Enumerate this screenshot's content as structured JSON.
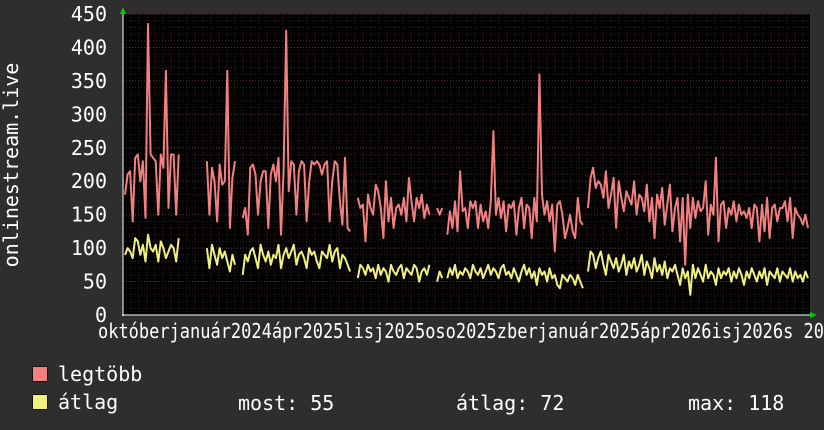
{
  "chart_data": {
    "type": "line",
    "ylabel": "onlinestream.live",
    "ylim": [
      0,
      450
    ],
    "yticks": [
      0,
      50,
      100,
      150,
      200,
      250,
      300,
      350,
      400,
      450
    ],
    "grid": true,
    "x_tick_labels": [
      "október",
      "2024 január",
      "2025 április",
      "2025 július",
      "2025 október",
      "2025 január",
      "2025 április",
      "2026 július",
      "2026 ..."
    ],
    "x_tick_label_text": "októberjanuár2024ápr2025lisj2025oso2025zberjanuár2025ápr2026isj2026s 20",
    "colors": {
      "background": "#2e2e2e",
      "plot": "#000000",
      "grid": "#5a2a2a",
      "axis": "#ffffff",
      "arrow": "#00cc00"
    },
    "series": [
      {
        "name": "legtöbb",
        "color": "#f28080",
        "values": [
          180,
          210,
          215,
          140,
          235,
          240,
          200,
          230,
          145,
          435,
          240,
          235,
          230,
          150,
          240,
          220,
          365,
          160,
          240,
          240,
          150,
          240,
          null,
          null,
          null,
          null,
          null,
          null,
          null,
          null,
          null,
          null,
          230,
          150,
          220,
          200,
          140,
          225,
          195,
          200,
          365,
          130,
          205,
          230,
          null,
          null,
          145,
          160,
          120,
          220,
          225,
          210,
          150,
          200,
          215,
          215,
          130,
          210,
          225,
          200,
          235,
          120,
          215,
          425,
          185,
          230,
          225,
          150,
          215,
          230,
          225,
          140,
          200,
          230,
          225,
          230,
          225,
          210,
          225,
          230,
          140,
          200,
          230,
          225,
          170,
          135,
          235,
          130,
          125,
          null,
          null,
          175,
          160,
          165,
          110,
          180,
          160,
          150,
          195,
          185,
          160,
          115,
          200,
          140,
          175,
          130,
          160,
          165,
          150,
          175,
          140,
          205,
          170,
          140,
          175,
          160,
          180,
          145,
          165,
          150,
          null,
          null,
          160,
          150,
          160,
          null,
          120,
          155,
          130,
          170,
          125,
          215,
          155,
          160,
          130,
          170,
          160,
          170,
          130,
          165,
          140,
          155,
          130,
          170,
          275,
          150,
          175,
          145,
          170,
          125,
          165,
          160,
          170,
          120,
          160,
          175,
          130,
          165,
          160,
          115,
          175,
          140,
          360,
          180,
          150,
          170,
          140,
          165,
          95,
          165,
          170,
          150,
          115,
          130,
          150,
          125,
          115,
          175,
          140,
          135,
          null,
          160,
          205,
          220,
          190,
          200,
          195,
          175,
          215,
          160,
          180,
          205,
          130,
          200,
          175,
          155,
          185,
          175,
          165,
          200,
          150,
          180,
          175,
          155,
          195,
          140,
          175,
          115,
          180,
          160,
          190,
          135,
          165,
          195,
          125,
          160,
          175,
          110,
          175,
          75,
          180,
          130,
          175,
          145,
          170,
          155,
          160,
          200,
          120,
          165,
          150,
          235,
          110,
          165,
          170,
          130,
          160,
          150,
          170,
          140,
          165,
          150,
          155,
          145,
          160,
          130,
          165,
          160,
          110,
          165,
          125,
          175,
          115,
          160,
          165,
          140,
          160,
          160,
          170,
          140,
          175,
          115,
          160,
          150,
          145,
          135,
          150,
          130
        ],
        "stats": {
          "most": 55,
          "atlag": 72,
          "max": 118
        }
      },
      {
        "name": "átlag",
        "color": "#f0f080",
        "values": [
          90,
          100,
          95,
          85,
          115,
          110,
          90,
          105,
          80,
          120,
          100,
          95,
          105,
          80,
          110,
          100,
          85,
          95,
          105,
          100,
          80,
          115,
          null,
          null,
          null,
          null,
          null,
          null,
          null,
          null,
          null,
          null,
          100,
          70,
          105,
          90,
          75,
          100,
          85,
          95,
          80,
          65,
          90,
          75,
          null,
          null,
          60,
          90,
          80,
          95,
          100,
          85,
          70,
          105,
          90,
          80,
          95,
          75,
          90,
          85,
          105,
          70,
          90,
          100,
          85,
          95,
          105,
          75,
          90,
          95,
          85,
          70,
          100,
          90,
          95,
          80,
          70,
          95,
          90,
          85,
          105,
          80,
          95,
          100,
          70,
          90,
          85,
          75,
          65,
          null,
          null,
          55,
          75,
          70,
          60,
          75,
          65,
          70,
          55,
          75,
          60,
          70,
          65,
          50,
          75,
          65,
          60,
          70,
          75,
          55,
          70,
          65,
          60,
          75,
          70,
          50,
          65,
          70,
          60,
          75,
          null,
          null,
          50,
          65,
          55,
          null,
          55,
          70,
          60,
          75,
          55,
          65,
          60,
          70,
          65,
          55,
          75,
          65,
          60,
          70,
          55,
          65,
          75,
          60,
          70,
          65,
          55,
          70,
          75,
          60,
          65,
          55,
          70,
          60,
          50,
          65,
          75,
          60,
          70,
          55,
          65,
          45,
          70,
          60,
          65,
          50,
          70,
          55,
          60,
          45,
          40,
          60,
          55,
          50,
          60,
          55,
          45,
          60,
          50,
          40,
          null,
          65,
          95,
          90,
          70,
          85,
          95,
          75,
          60,
          90,
          80,
          70,
          85,
          65,
          75,
          90,
          60,
          80,
          70,
          85,
          65,
          75,
          90,
          60,
          80,
          70,
          55,
          85,
          65,
          75,
          60,
          80,
          55,
          70,
          65,
          75,
          60,
          45,
          70,
          55,
          65,
          30,
          75,
          55,
          70,
          60,
          50,
          75,
          55,
          65,
          60,
          45,
          70,
          55,
          65,
          60,
          70,
          50,
          65,
          55,
          70,
          60,
          45,
          65,
          55,
          70,
          60,
          50,
          65,
          55,
          70,
          45,
          65,
          60,
          55,
          70,
          50,
          65,
          60,
          55,
          70,
          50,
          65,
          55,
          60,
          50,
          65,
          55
        ],
        "stats": {}
      }
    ]
  },
  "legend": {
    "series1_label": "legtöbb",
    "series2_label": "átlag",
    "stat_most": "most: 55",
    "stat_atlag": "átlag: 72",
    "stat_max": "max: 118"
  }
}
